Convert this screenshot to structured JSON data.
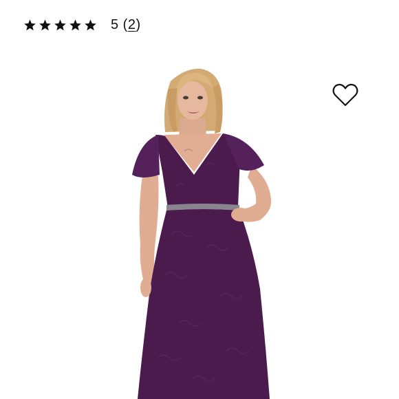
{
  "rating": {
    "stars": 5,
    "score": "5",
    "open_paren": " (",
    "count": "2",
    "close_paren": ")"
  },
  "icons": {
    "star": "star-icon",
    "wishlist": "heart-outline-icon"
  },
  "colors": {
    "dress": "#4a1b4c",
    "skin": "#e3b49a",
    "hair": "#d9b27d",
    "belt": "#8a8390",
    "text": "#111111"
  }
}
